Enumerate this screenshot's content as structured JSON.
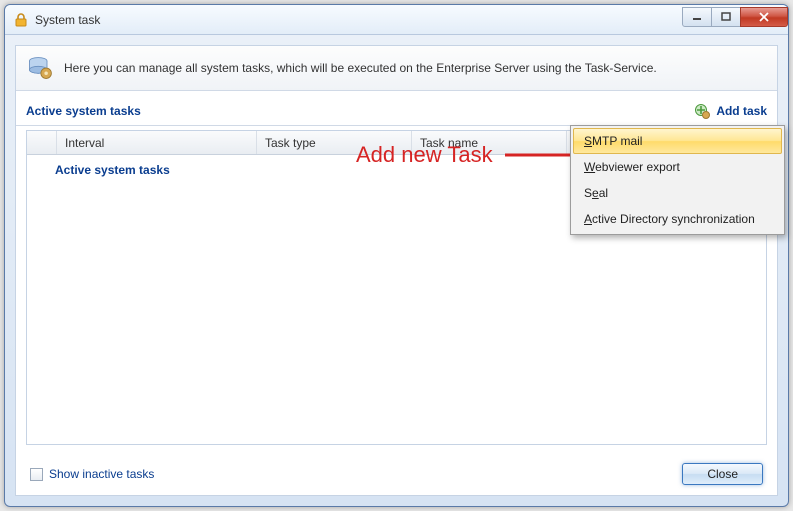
{
  "window": {
    "title": "System task"
  },
  "info": {
    "text": "Here you can manage all system tasks, which will be executed on the Enterprise Server using the Task-Service."
  },
  "section": {
    "title": "Active system tasks",
    "add_task_label": "Add task"
  },
  "annotation": {
    "label": "Add new Task"
  },
  "columns": {
    "interval": "Interval",
    "task_type": "Task type",
    "task_name": "Task name"
  },
  "group_row": "Active system tasks",
  "menu": {
    "items": [
      {
        "label": "SMTP mail",
        "mnemonic_index": 0,
        "selected": true
      },
      {
        "label": "Webviewer export",
        "mnemonic_index": 0,
        "selected": false
      },
      {
        "label": "Seal",
        "mnemonic_index": 1,
        "selected": false
      },
      {
        "label": "Active Directory synchronization",
        "mnemonic_index": 0,
        "selected": false
      }
    ]
  },
  "footer": {
    "show_inactive": "Show inactive tasks",
    "close": "Close"
  }
}
